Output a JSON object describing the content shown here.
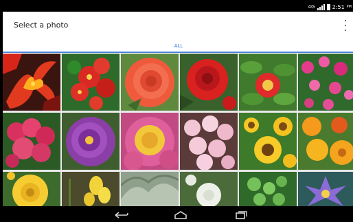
{
  "status_bar": {
    "network": "4G",
    "time": "2:51",
    "am_pm": "PM",
    "signal_icon": "signal-bars-icon",
    "battery_icon": "battery-icon"
  },
  "toolbar": {
    "title": "Select a photo",
    "overflow_icon": "kebab-menu-icon"
  },
  "tabs": [
    {
      "label": "ALL",
      "selected": true
    }
  ],
  "colors": {
    "tab_accent": "#4b86dd",
    "status_bar_bg": "#000000",
    "navigation_bar_bg": "#000000"
  },
  "photos": [
    {
      "row": 0,
      "col": 0,
      "subject": "orange and red lily"
    },
    {
      "row": 0,
      "col": 1,
      "subject": "red flower cluster"
    },
    {
      "row": 0,
      "col": 2,
      "subject": "orange rose"
    },
    {
      "row": 0,
      "col": 3,
      "subject": "red camellia"
    },
    {
      "row": 0,
      "col": 4,
      "subject": "red camellia with leaves"
    },
    {
      "row": 0,
      "col": 5,
      "subject": "pink flower field"
    },
    {
      "row": 1,
      "col": 0,
      "subject": "pink blossom cluster"
    },
    {
      "row": 1,
      "col": 1,
      "subject": "purple peony"
    },
    {
      "row": 1,
      "col": 2,
      "subject": "pink peony with yellow center"
    },
    {
      "row": 1,
      "col": 3,
      "subject": "pink cherry blossoms"
    },
    {
      "row": 1,
      "col": 4,
      "subject": "yellow sunflowers"
    },
    {
      "row": 1,
      "col": 5,
      "subject": "orange and yellow flowers"
    },
    {
      "row": 2,
      "col": 0,
      "subject": "yellow rose"
    },
    {
      "row": 2,
      "col": 1,
      "subject": "yellow flowers"
    },
    {
      "row": 2,
      "col": 2,
      "subject": "silver foliage"
    },
    {
      "row": 2,
      "col": 3,
      "subject": "white flowers"
    },
    {
      "row": 2,
      "col": 4,
      "subject": "green round leaves"
    },
    {
      "row": 2,
      "col": 5,
      "subject": "purple water lily"
    }
  ],
  "navigation_bar": {
    "back_icon": "back-arrow-icon",
    "home_icon": "home-icon",
    "recents_icon": "recent-apps-icon"
  }
}
